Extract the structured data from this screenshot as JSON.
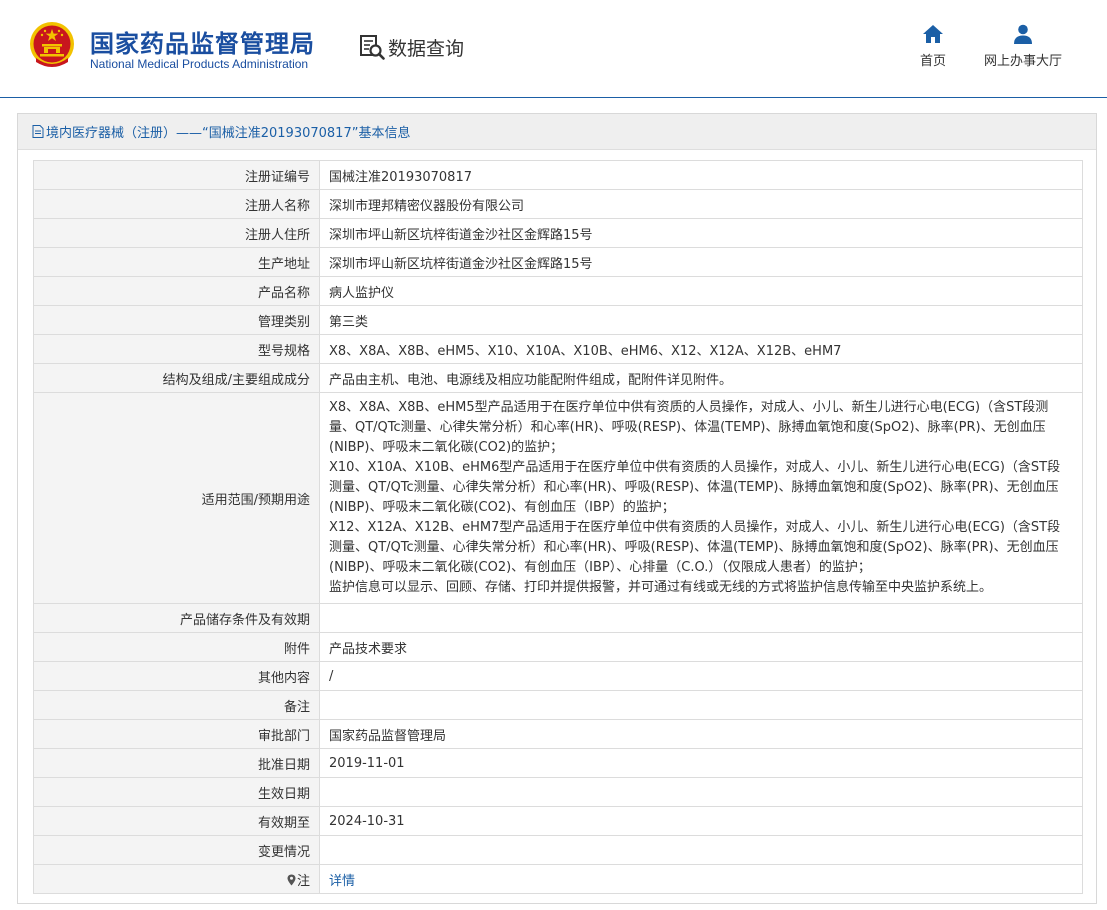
{
  "header": {
    "org_cn": "国家药品监督管理局",
    "org_en": "National Medical Products Administration",
    "query_label": "数据查询",
    "nav": [
      {
        "icon": "home-icon",
        "label": "首页"
      },
      {
        "icon": "user-icon",
        "label": "网上办事大厅"
      }
    ]
  },
  "colors": {
    "brand_blue": "#1a4ea0",
    "link_blue": "#1b5fa6",
    "emblem_red": "#c8161d",
    "emblem_gold": "#f2c200"
  },
  "panel": {
    "title": "境内医疗器械（注册）——“国械注准20193070817”基本信息"
  },
  "rows": [
    {
      "key": "注册证编号",
      "value": "国械注准20193070817"
    },
    {
      "key": "注册人名称",
      "value": "深圳市理邦精密仪器股份有限公司"
    },
    {
      "key": "注册人住所",
      "value": "深圳市坪山新区坑梓街道金沙社区金辉路15号"
    },
    {
      "key": "生产地址",
      "value": "深圳市坪山新区坑梓街道金沙社区金辉路15号"
    },
    {
      "key": "产品名称",
      "value": "病人监护仪"
    },
    {
      "key": "管理类别",
      "value": "第三类"
    },
    {
      "key": "型号规格",
      "value": "X8、X8A、X8B、eHM5、X10、X10A、X10B、eHM6、X12、X12A、X12B、eHM7"
    },
    {
      "key": "结构及组成/主要组成成分",
      "value": "产品由主机、电池、电源线及相应功能配附件组成，配附件详见附件。"
    },
    {
      "key": "适用范围/预期用途",
      "lines": [
        "X8、X8A、X8B、eHM5型产品适用于在医疗单位中供有资质的人员操作，对成人、小儿、新生儿进行心电(ECG)（含ST段测量、QT/QTc测量、心律失常分析）和心率(HR)、呼吸(RESP)、体温(TEMP)、脉搏血氧饱和度(SpO2)、脉率(PR)、无创血压(NIBP)、呼吸末二氧化碳(CO2)的监护；",
        "X10、X10A、X10B、eHM6型产品适用于在医疗单位中供有资质的人员操作，对成人、小儿、新生儿进行心电(ECG)（含ST段测量、QT/QTc测量、心律失常分析）和心率(HR)、呼吸(RESP)、体温(TEMP)、脉搏血氧饱和度(SpO2)、脉率(PR)、无创血压(NIBP)、呼吸末二氧化碳(CO2)、有创血压（IBP）的监护；",
        "X12、X12A、X12B、eHM7型产品适用于在医疗单位中供有资质的人员操作，对成人、小儿、新生儿进行心电(ECG)（含ST段测量、QT/QTc测量、心律失常分析）和心率(HR)、呼吸(RESP)、体温(TEMP)、脉搏血氧饱和度(SpO2)、脉率(PR)、无创血压(NIBP)、呼吸末二氧化碳(CO2)、有创血压（IBP）、心排量（C.O.）（仅限成人患者）的监护；",
        "监护信息可以显示、回顾、存储、打印并提供报警，并可通过有线或无线的方式将监护信息传输至中央监护系统上。"
      ]
    },
    {
      "key": "产品储存条件及有效期",
      "value": ""
    },
    {
      "key": "附件",
      "value": "产品技术要求"
    },
    {
      "key": "其他内容",
      "value": "/"
    },
    {
      "key": "备注",
      "value": ""
    },
    {
      "key": "审批部门",
      "value": "国家药品监督管理局"
    },
    {
      "key": "批准日期",
      "value": "2019-11-01"
    },
    {
      "key": "生效日期",
      "value": ""
    },
    {
      "key": "有效期至",
      "value": "2024-10-31"
    },
    {
      "key": "变更情况",
      "value": ""
    },
    {
      "key": "注",
      "key_icon": "pin-icon",
      "value": "详情"
    }
  ]
}
